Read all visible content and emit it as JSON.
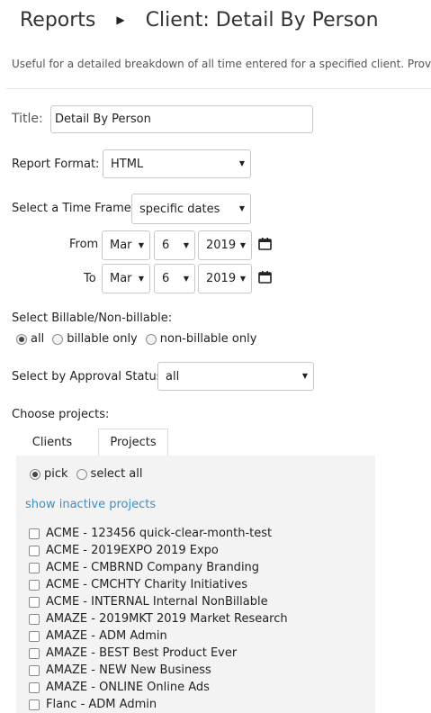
{
  "header": {
    "crumb_parent": "Reports",
    "crumb_current": "Client: Detail By Person",
    "separator": "▶"
  },
  "description": "Useful for a detailed breakdown of all time entered for a specified client. Provides ti",
  "title_field": {
    "label": "Title:",
    "value": "Detail By Person"
  },
  "report_format": {
    "label": "Report Format:",
    "value": "HTML"
  },
  "time_frame": {
    "label": "Select a Time Frame:",
    "value": "specific dates"
  },
  "from": {
    "label": "From",
    "month": "Mar",
    "day": "6",
    "year": "2019"
  },
  "to": {
    "label": "To",
    "month": "Mar",
    "day": "6",
    "year": "2019"
  },
  "billable": {
    "label": "Select Billable/Non-billable:",
    "options": [
      "all",
      "billable only",
      "non-billable only"
    ],
    "selected": "all"
  },
  "approval": {
    "label": "Select by Approval Status:",
    "value": "all"
  },
  "projects": {
    "label": "Choose projects:",
    "tabs": [
      "Clients",
      "Projects"
    ],
    "active_tab": "Projects",
    "pick_options": [
      "pick",
      "select all"
    ],
    "selected_pick": "pick",
    "show_inactive": "show inactive projects",
    "items": [
      "ACME - 123456 quick-clear-month-test",
      "ACME - 2019EXPO 2019 Expo",
      "ACME - CMBRND Company Branding",
      "ACME - CMCHTY Charity Initiatives",
      "ACME - INTERNAL Internal NonBillable",
      "AMAZE - 2019MKT 2019 Market Research",
      "AMAZE - ADM Admin",
      "AMAZE - BEST Best Product Ever",
      "AMAZE - NEW New Business",
      "AMAZE - ONLINE Online Ads",
      "Flanc - ADM Admin"
    ]
  },
  "icons": {
    "caret": "caret-down-icon",
    "calendar": "calendar-icon"
  }
}
